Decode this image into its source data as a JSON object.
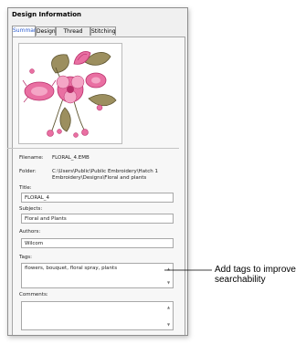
{
  "panel": {
    "title": "Design Information"
  },
  "tabs": [
    {
      "label": "Summary",
      "active": true
    },
    {
      "label": "Design",
      "active": false
    },
    {
      "label": "Thread Colors",
      "active": false
    },
    {
      "label": "Stitching",
      "active": false
    }
  ],
  "info": {
    "filename_label": "Filename:",
    "filename_value": "FLORAL_4.EMB",
    "folder_label": "Folder:",
    "folder_value_line1": "C:\\Users\\Public\\Public Embroidery\\Hatch 1",
    "folder_value_line2": "Embroidery\\Designs\\Floral and plants",
    "title_label": "Title:",
    "title_value": "FLORAL_4",
    "subjects_label": "Subjects:",
    "subjects_value": "Floral and Plants",
    "authors_label": "Authors:",
    "authors_value": "Wilcom",
    "tags_label": "Tags:",
    "tags_value": "flowers, bouquet, floral spray, plants",
    "comments_label": "Comments:",
    "comments_value": ""
  },
  "annotation": {
    "line1": "Add tags to improve",
    "line2": "searchability"
  },
  "colors": {
    "panel_bg": "#f0f0f0",
    "tab_active_text": "#2a5bd0",
    "petal_pink": "#e96fa2",
    "petal_dark": "#b82e6a",
    "leaf_olive": "#9c8f5f",
    "leaf_dark": "#5e5530"
  }
}
